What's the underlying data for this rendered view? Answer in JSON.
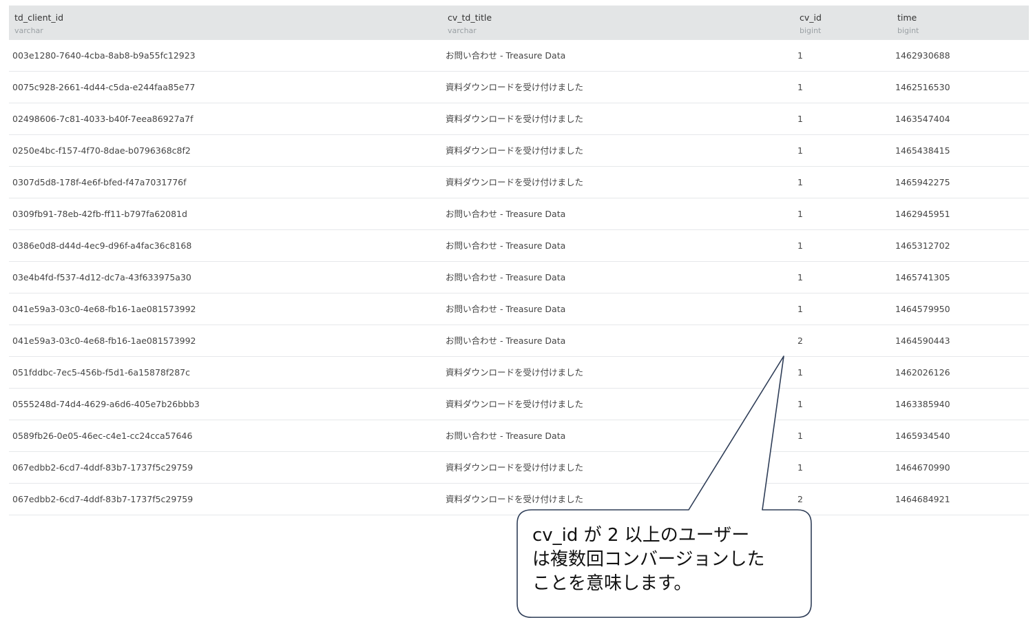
{
  "table": {
    "columns": [
      {
        "name": "td_client_id",
        "type": "varchar"
      },
      {
        "name": "cv_td_title",
        "type": "varchar"
      },
      {
        "name": "cv_id",
        "type": "bigint"
      },
      {
        "name": "time",
        "type": "bigint"
      }
    ],
    "rows": [
      [
        "003e1280-7640-4cba-8ab8-b9a55fc12923",
        "お問い合わせ - Treasure Data",
        "1",
        "1462930688"
      ],
      [
        "0075c928-2661-4d44-c5da-e244faa85e77",
        "資料ダウンロードを受け付けました",
        "1",
        "1462516530"
      ],
      [
        "02498606-7c81-4033-b40f-7eea86927a7f",
        "資料ダウンロードを受け付けました",
        "1",
        "1463547404"
      ],
      [
        "0250e4bc-f157-4f70-8dae-b0796368c8f2",
        "資料ダウンロードを受け付けました",
        "1",
        "1465438415"
      ],
      [
        "0307d5d8-178f-4e6f-bfed-f47a7031776f",
        "資料ダウンロードを受け付けました",
        "1",
        "1465942275"
      ],
      [
        "0309fb91-78eb-42fb-ff11-b797fa62081d",
        "お問い合わせ - Treasure Data",
        "1",
        "1462945951"
      ],
      [
        "0386e0d8-d44d-4ec9-d96f-a4fac36c8168",
        "お問い合わせ - Treasure Data",
        "1",
        "1465312702"
      ],
      [
        "03e4b4fd-f537-4d12-dc7a-43f633975a30",
        "お問い合わせ - Treasure Data",
        "1",
        "1465741305"
      ],
      [
        "041e59a3-03c0-4e68-fb16-1ae081573992",
        "お問い合わせ - Treasure Data",
        "1",
        "1464579950"
      ],
      [
        "041e59a3-03c0-4e68-fb16-1ae081573992",
        "お問い合わせ - Treasure Data",
        "2",
        "1464590443"
      ],
      [
        "051fddbc-7ec5-456b-f5d1-6a15878f287c",
        "資料ダウンロードを受け付けました",
        "1",
        "1462026126"
      ],
      [
        "0555248d-74d4-4629-a6d6-405e7b26bbb3",
        "資料ダウンロードを受け付けました",
        "1",
        "1463385940"
      ],
      [
        "0589fb26-0e05-46ec-c4e1-cc24cca57646",
        "お問い合わせ - Treasure Data",
        "1",
        "1465934540"
      ],
      [
        "067edbb2-6cd7-4ddf-83b7-1737f5c29759",
        "資料ダウンロードを受け付けました",
        "1",
        "1464670990"
      ],
      [
        "067edbb2-6cd7-4ddf-83b7-1737f5c29759",
        "資料ダウンロードを受け付けました",
        "2",
        "1464684921"
      ]
    ]
  },
  "callout": {
    "text": "cv_id が 2 以上のユーザー\nは複数回コンバージョンした\nことを意味します。",
    "border_color": "#2e3d57"
  }
}
